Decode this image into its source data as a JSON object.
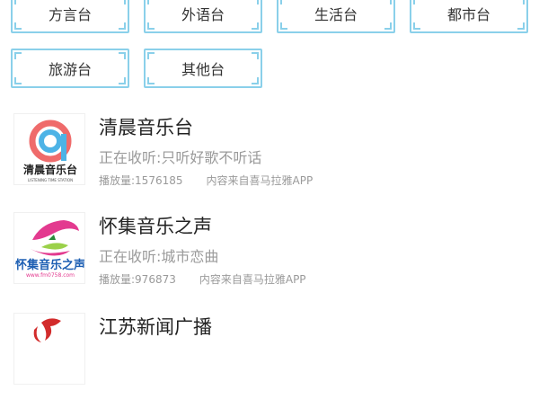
{
  "categories": [
    {
      "label": "方言台"
    },
    {
      "label": "外语台"
    },
    {
      "label": "生活台"
    },
    {
      "label": "都市台"
    },
    {
      "label": "旅游台"
    },
    {
      "label": "其他台"
    }
  ],
  "stations": [
    {
      "name": "清晨音乐台",
      "now_playing": "正在收听:只听好歌不听话",
      "plays": "播放量:1576185",
      "source": "内容来自喜马拉雅APP",
      "logo_text": "清晨音乐台",
      "logo_sub": "LISTENING TIME STATION",
      "logo_icon": "music-a-icon"
    },
    {
      "name": "怀集音乐之声",
      "now_playing": "正在收听:城市恋曲",
      "plays": "播放量:976873",
      "source": "内容来自喜马拉雅APP",
      "logo_text": "怀集音乐之声",
      "logo_sub": "www.fm0758.com",
      "logo_icon": "swallow-icon"
    },
    {
      "name": "江苏新闻广播",
      "logo_icon": "jsbc-icon"
    }
  ]
}
